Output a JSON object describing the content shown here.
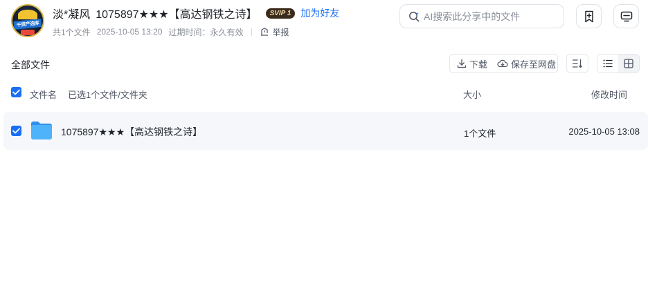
{
  "header": {
    "avatar_text": "干货产选库",
    "sharer_name": "淡*凝风",
    "share_title": "1075897★★★【高达钢铁之诗】",
    "vip_badge": "SVIP 1",
    "add_friend_label": "加为好友",
    "meta": {
      "count_text": "共1个文件",
      "share_time": "2025-10-05 13:20",
      "expire_label": "过期时间：永久有效",
      "report_label": "举报"
    },
    "search": {
      "placeholder": "AI搜索此分享中的文件",
      "value": ""
    },
    "icons": {
      "add_bookmark": "bookmark-plus-icon",
      "monitor": "monitor-icon"
    }
  },
  "toolbar": {
    "all_files_label": "全部文件",
    "download_label": "下载",
    "save_label": "保存至网盘",
    "sort_icon": "sort-icon",
    "view_list_icon": "list-view-icon",
    "view_grid_icon": "grid-view-icon"
  },
  "table": {
    "headers": {
      "name": "文件名",
      "selected": "已选1个文件/文件夹",
      "size": "大小",
      "modified": "修改时间"
    },
    "rows": [
      {
        "name": "1075897★★★【高达钢铁之诗】",
        "size": "1个文件",
        "modified": "2025-10-05 13:08",
        "checked": true,
        "icon": "folder-icon"
      }
    ]
  },
  "colors": {
    "accent": "#1a6ef5",
    "folder": "#4aa8f7",
    "row_bg": "#f5f7fa",
    "text": "#1f2329",
    "muted": "#8a8f99"
  }
}
